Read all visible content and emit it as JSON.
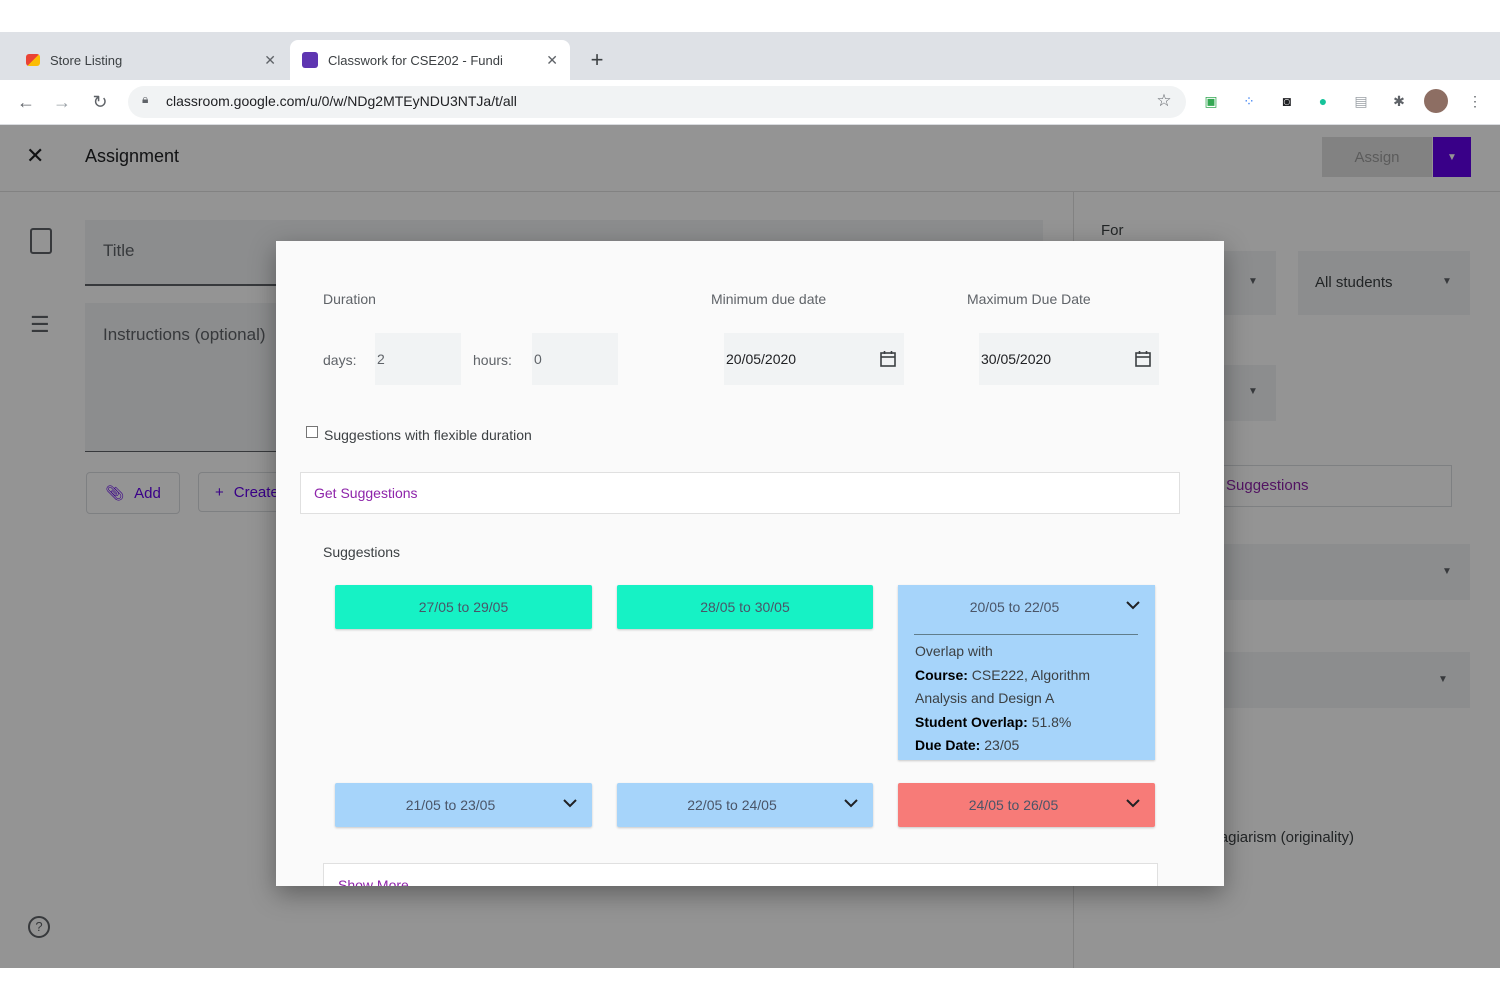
{
  "browser": {
    "tabs": [
      {
        "title": "Store Listing",
        "favicon_color": "#e8710a"
      },
      {
        "title": "Classwork for CSE202 - Fundi",
        "favicon_color": "#5e35b1"
      }
    ],
    "new_tab_label": "+",
    "url": "classroom.google.com/u/0/w/NDg2MTEyNDU3NTJa/t/all"
  },
  "app": {
    "title": "Assignment",
    "assign_label": "Assign",
    "title_placeholder": "Title",
    "instructions_placeholder": "Instructions (optional)",
    "add_label": "Add",
    "create_label": "Create",
    "right_panel": {
      "for_label": "For",
      "students_value": "All students",
      "suggestions_link": "Suggestions",
      "plagiarism_text": "plagiarism (originality)"
    },
    "accent_color": "#6200ea"
  },
  "modal": {
    "duration_label": "Duration",
    "days_label": "days:",
    "days_value": "2",
    "hours_label": "hours:",
    "hours_value": "0",
    "min_due_label": "Minimum due date",
    "min_due_value": "20/05/2020",
    "max_due_label": "Maximum Due Date",
    "max_due_value": "30/05/2020",
    "flexible_checkbox_label": "Suggestions with flexible duration",
    "flexible_checked": false,
    "get_suggestions_label": "Get Suggestions",
    "suggestions_heading": "Suggestions",
    "suggestions_row1": [
      {
        "range": "27/05 to 29/05",
        "status": "free"
      },
      {
        "range": "28/05 to 30/05",
        "status": "free"
      },
      {
        "range": "20/05 to 22/05",
        "status": "overlap",
        "expanded": true
      }
    ],
    "expanded_detail": {
      "heading": "Overlap with",
      "course_label": "Course:",
      "course_value": "CSE222, Algorithm Analysis and Design A",
      "overlap_label": "Student Overlap:",
      "overlap_value": "51.8%",
      "due_label": "Due Date:",
      "due_value": "23/05"
    },
    "suggestions_row2": [
      {
        "range": "21/05 to 23/05",
        "status": "overlap"
      },
      {
        "range": "22/05 to 24/05",
        "status": "overlap"
      },
      {
        "range": "24/05 to 26/05",
        "status": "conflict"
      }
    ],
    "show_more_label": "Show More",
    "colors": {
      "free": "#16f2c5",
      "overlap": "#a6d4fa",
      "conflict": "#f77b78",
      "link": "#8e24aa"
    }
  }
}
